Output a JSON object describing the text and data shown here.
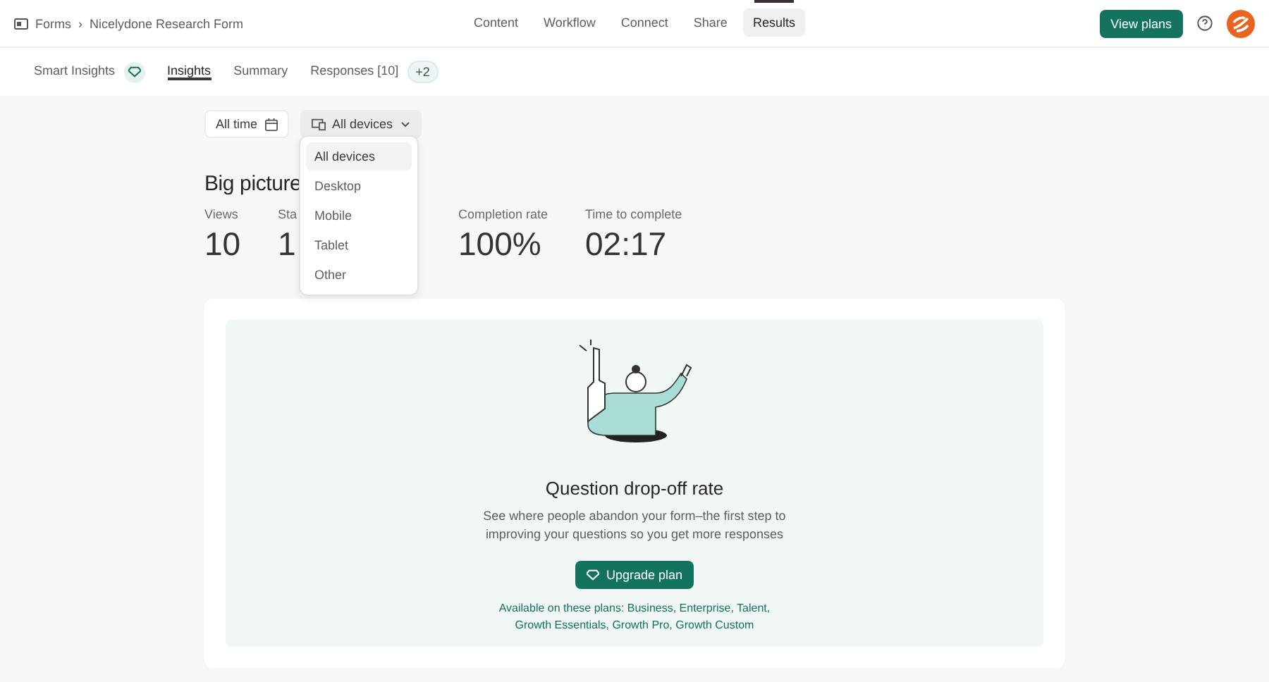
{
  "breadcrumb": {
    "root": "Forms",
    "separator": "›",
    "current": "Nicelydone Research Form"
  },
  "nav": [
    {
      "label": "Content",
      "selected": false
    },
    {
      "label": "Workflow",
      "selected": false
    },
    {
      "label": "Connect",
      "selected": false
    },
    {
      "label": "Share",
      "selected": false
    },
    {
      "label": "Results",
      "selected": true
    }
  ],
  "view_plans": "View plans",
  "tabs": [
    {
      "label": "Smart Insights",
      "selected": false,
      "kind": "premium"
    },
    {
      "label": "Insights",
      "selected": true,
      "kind": "plain"
    },
    {
      "label": "Summary",
      "selected": false,
      "kind": "plain"
    },
    {
      "label": "Responses [10]",
      "selected": false,
      "kind": "count",
      "badge": "+2"
    }
  ],
  "filters": {
    "time": "All time",
    "devices": "All devices"
  },
  "device_menu": [
    {
      "label": "All devices",
      "selected": true
    },
    {
      "label": "Desktop",
      "selected": false
    },
    {
      "label": "Mobile",
      "selected": false
    },
    {
      "label": "Tablet",
      "selected": false
    },
    {
      "label": "Other",
      "selected": false
    }
  ],
  "section_title": "Big picture",
  "stats": [
    {
      "label": "Views",
      "value": "10"
    },
    {
      "label": "Sta",
      "value": "1"
    },
    {
      "label": "Completion rate",
      "value": "100%"
    },
    {
      "label": "Time to complete",
      "value": "02:17"
    }
  ],
  "upsell": {
    "title": "Question drop-off rate",
    "text": "See where people abandon your form–the first step to improving your questions so you get more responses",
    "button": "Upgrade plan",
    "plans": "Available on these plans: Business, Enterprise, Talent, Growth Essentials, Growth Pro, Growth Custom"
  }
}
